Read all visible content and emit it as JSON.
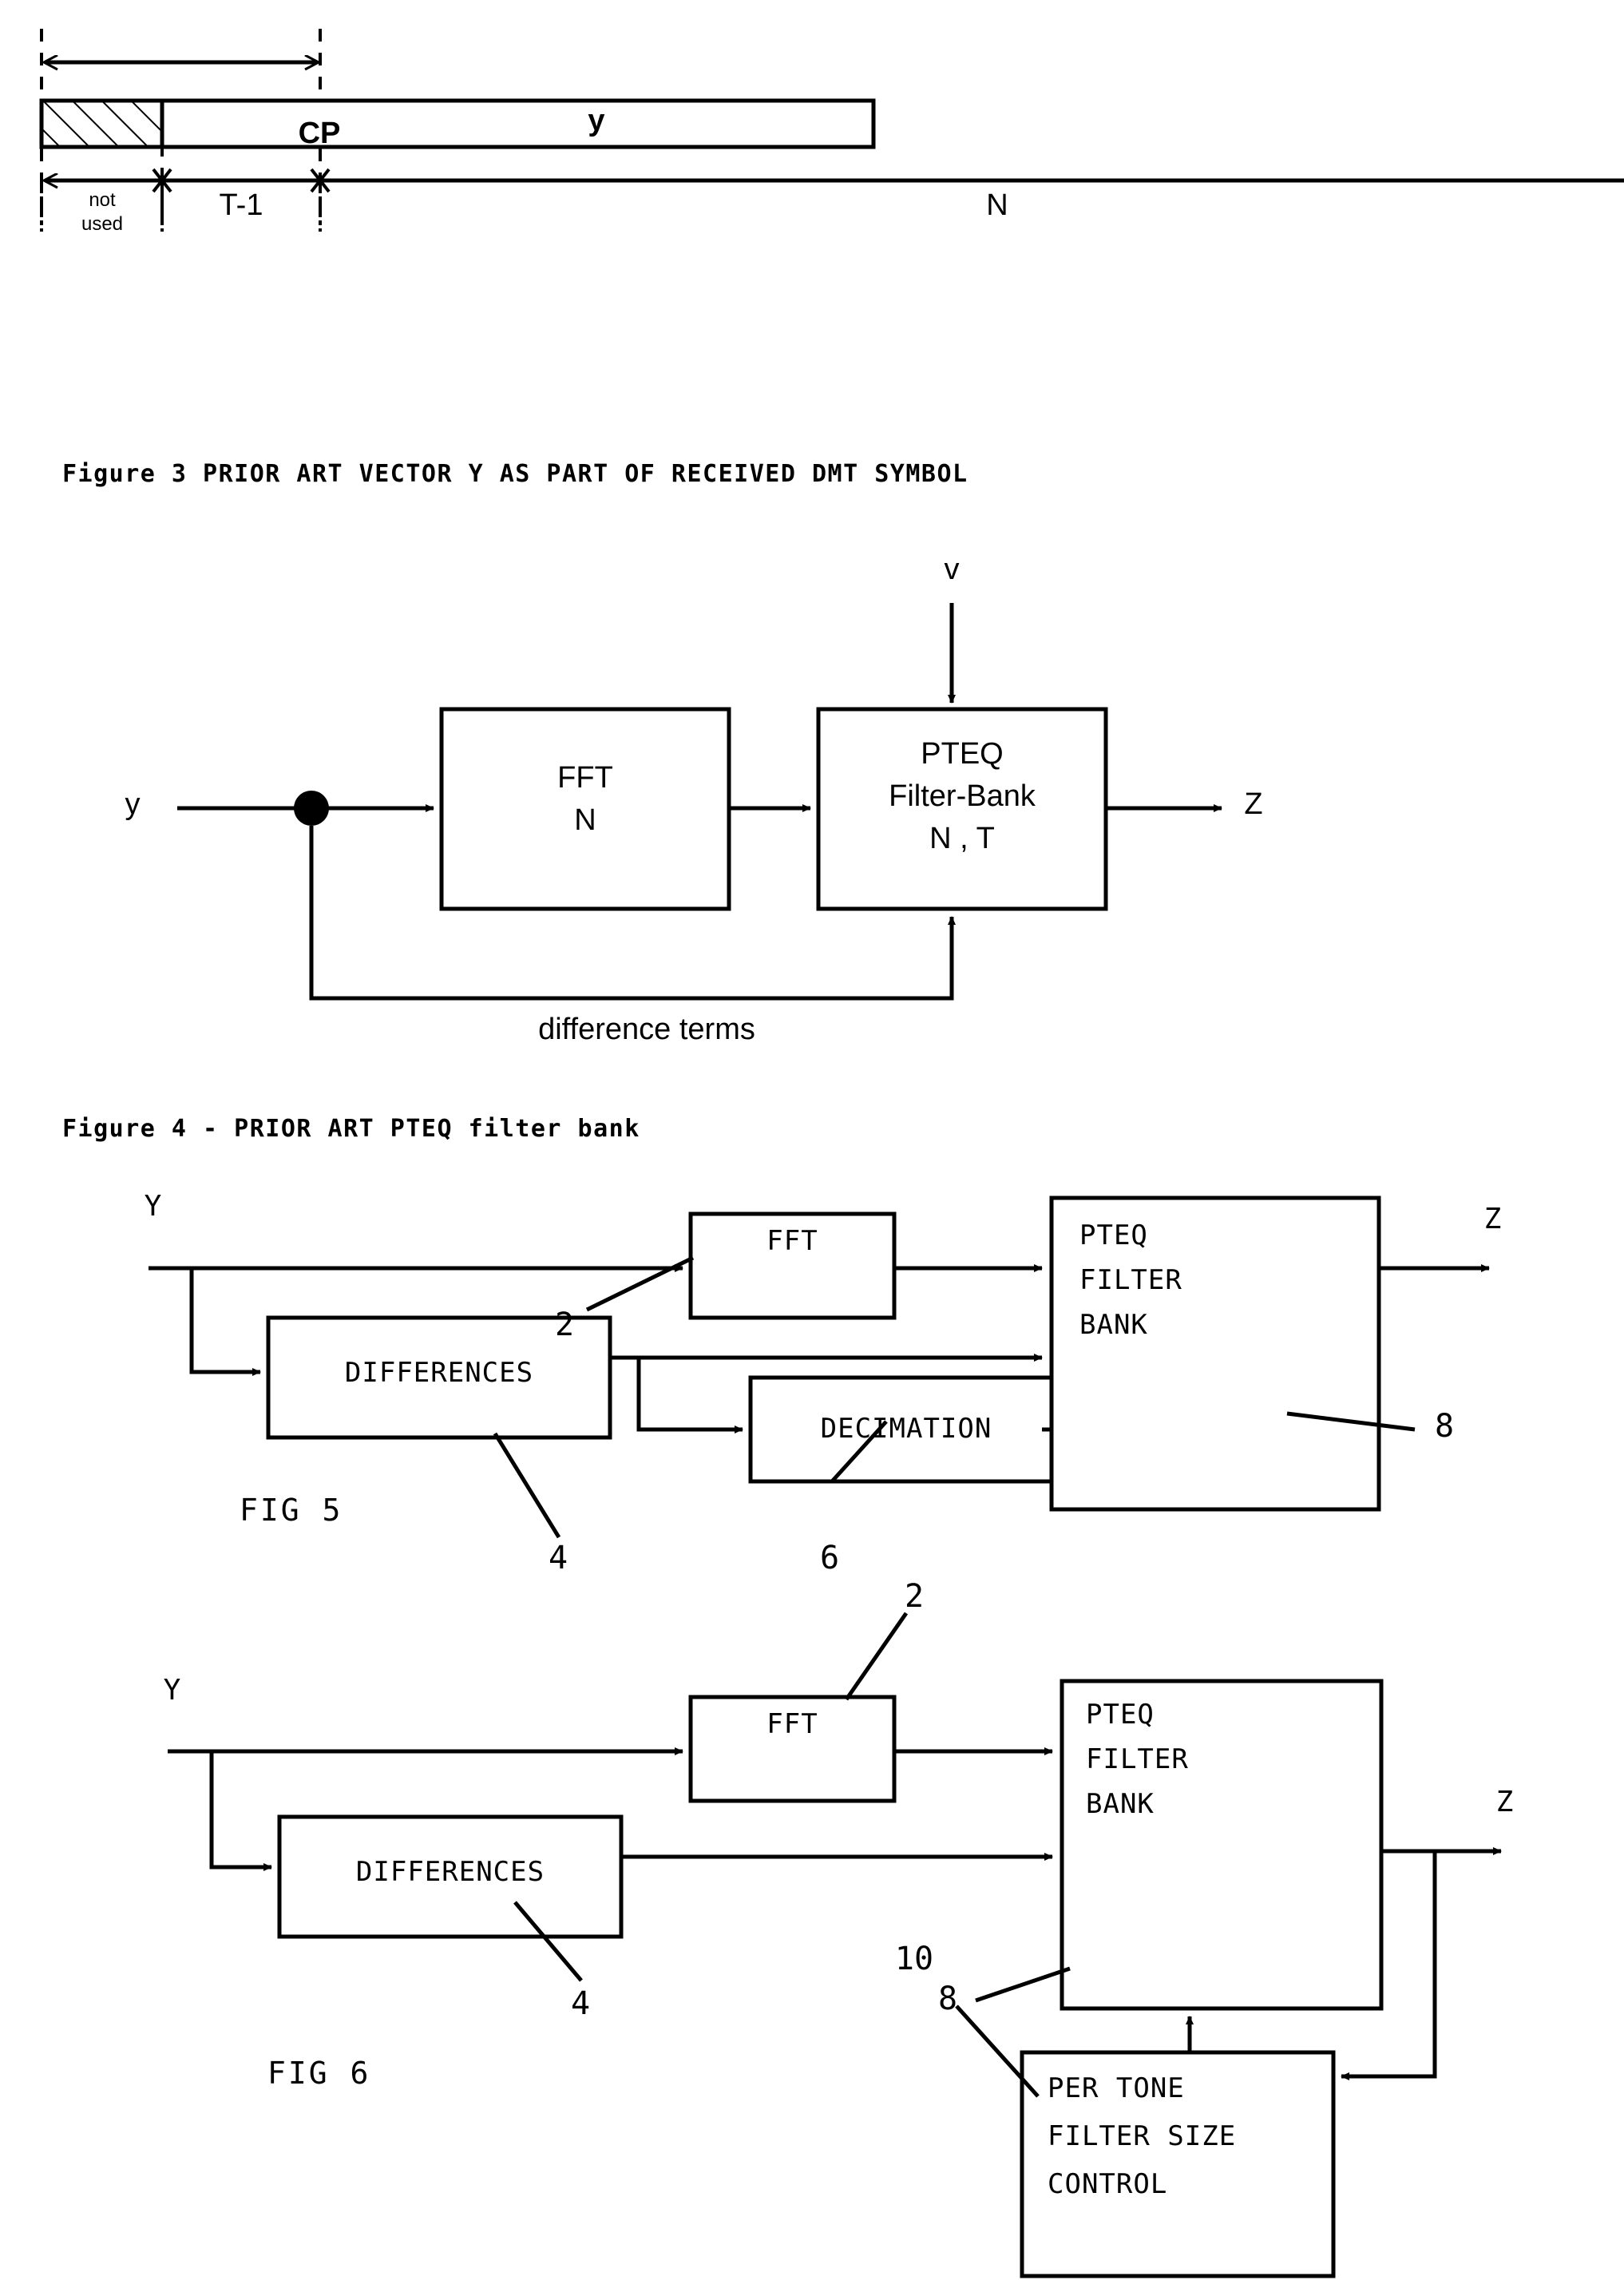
{
  "figure3": {
    "name": "PRIOR ART VECTOR Y AS PART OF RECEIVED DMT SYMBOL",
    "caption": "Figure 3 PRIOR ART VECTOR Y AS PART OF RECEIVED DMT SYMBOL",
    "cp_label": "CP",
    "y_label": "y",
    "not_used_line1": "not",
    "not_used_line2": "used",
    "t_minus_1_label": "T-1",
    "n_label": "N"
  },
  "figure4": {
    "caption": "Figure 4 - PRIOR ART PTEQ filter bank",
    "input_label": "y",
    "v_label": "v",
    "output_label": "Z",
    "fft_line1": "FFT",
    "fft_line2": "N",
    "pteq_line1": "PTEQ",
    "pteq_line2": "Filter-Bank",
    "pteq_line3": "N , T",
    "feedback_label": "difference terms"
  },
  "figure5": {
    "fig_label": "FIG 5",
    "input_label": "Y",
    "output_label": "Z",
    "fft_label": "FFT",
    "differences_label": "DIFFERENCES",
    "decimation_label": "DECIMATION",
    "pteq_line1": "PTEQ",
    "pteq_line2": "FILTER",
    "pteq_line3": "BANK",
    "ref_fft": "2",
    "ref_differences": "4",
    "ref_decimation": "6",
    "ref_pteq": "8"
  },
  "figure6": {
    "fig_label": "FIG 6",
    "input_label": "Y",
    "output_label": "Z",
    "fft_label": "FFT",
    "differences_label": "DIFFERENCES",
    "pteq_line1": "PTEQ",
    "pteq_line2": "FILTER",
    "pteq_line3": "BANK",
    "control_line1": "PER TONE",
    "control_line2": "FILTER SIZE",
    "control_line3": "CONTROL",
    "ref_fft": "2",
    "ref_differences": "4",
    "ref_pteq": "8",
    "ref_control": "10"
  },
  "colors": {
    "ink": "#000000",
    "paper": "#ffffff"
  }
}
